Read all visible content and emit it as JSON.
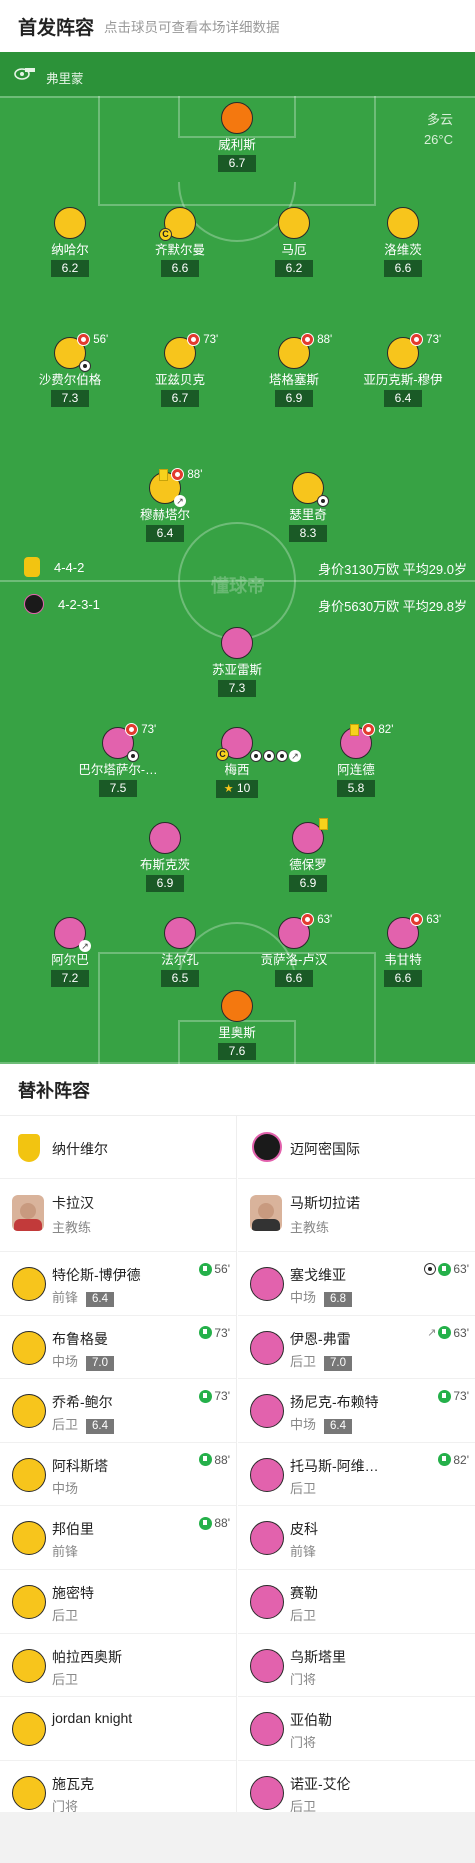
{
  "header": {
    "title": "首发阵容",
    "hint": "点击球员可查看本场详细数据"
  },
  "referee": {
    "name": "弗里蒙",
    "icon": "whistle-icon"
  },
  "weather": {
    "condition": "多云",
    "temp": "26°C"
  },
  "watermark": "懂球帝",
  "home_team": {
    "formation": "4-4-2",
    "value_text": "身价3130万欧 平均29.0岁"
  },
  "away_team": {
    "formation": "4-2-3-1",
    "value_text": "身价5630万欧 平均29.8岁"
  },
  "home_players": [
    {
      "name": "威利斯",
      "rating": "6.7"
    },
    {
      "name": "纳哈尔",
      "rating": "6.2"
    },
    {
      "name": "齐默尔曼",
      "rating": "6.6"
    },
    {
      "name": "马厄",
      "rating": "6.2"
    },
    {
      "name": "洛维茨",
      "rating": "6.6"
    },
    {
      "name": "沙费尔伯格",
      "rating": "7.3",
      "sub": "56'"
    },
    {
      "name": "亚兹贝克",
      "rating": "6.7",
      "sub": "73'"
    },
    {
      "name": "塔格塞斯",
      "rating": "6.9",
      "sub": "88'"
    },
    {
      "name": "亚历克斯-穆伊",
      "rating": "6.4",
      "sub": "73'"
    },
    {
      "name": "穆赫塔尔",
      "rating": "6.4",
      "sub": "88'"
    },
    {
      "name": "瑟里奇",
      "rating": "8.3"
    }
  ],
  "away_players": [
    {
      "name": "苏亚雷斯",
      "rating": "7.3"
    },
    {
      "name": "巴尔塔萨尔-…",
      "rating": "7.5",
      "sub": "73'"
    },
    {
      "name": "梅西",
      "rating": "10"
    },
    {
      "name": "阿连德",
      "rating": "5.8",
      "sub": "82'"
    },
    {
      "name": "布斯克茨",
      "rating": "6.9"
    },
    {
      "name": "德保罗",
      "rating": "6.9"
    },
    {
      "name": "阿尔巴",
      "rating": "7.2"
    },
    {
      "name": "法尔孔",
      "rating": "6.5"
    },
    {
      "name": "贡萨洛-卢汉",
      "rating": "6.6",
      "sub": "63'"
    },
    {
      "name": "韦甘特",
      "rating": "6.6",
      "sub": "63'"
    },
    {
      "name": "里奥斯",
      "rating": "7.6"
    }
  ],
  "subs": {
    "title": "替补阵容",
    "home": {
      "team": "纳什维尔",
      "coach": {
        "name": "卡拉汉",
        "role": "主教练"
      },
      "players": [
        {
          "name": "特伦斯-博伊德",
          "pos": "前锋",
          "rating": "6.4",
          "in": "56'"
        },
        {
          "name": "布鲁格曼",
          "pos": "中场",
          "rating": "7.0",
          "in": "73'"
        },
        {
          "name": "乔希-鲍尔",
          "pos": "后卫",
          "rating": "6.4",
          "in": "73'"
        },
        {
          "name": "阿科斯塔",
          "pos": "中场",
          "rating": "",
          "in": "88'"
        },
        {
          "name": "邦伯里",
          "pos": "前锋",
          "rating": "",
          "in": "88'"
        },
        {
          "name": "施密特",
          "pos": "后卫",
          "rating": "",
          "in": ""
        },
        {
          "name": "帕拉西奥斯",
          "pos": "后卫",
          "rating": "",
          "in": ""
        },
        {
          "name": "jordan knight",
          "pos": "",
          "rating": "",
          "in": ""
        },
        {
          "name": "施瓦克",
          "pos": "门将",
          "rating": "",
          "in": ""
        }
      ]
    },
    "away": {
      "team": "迈阿密国际",
      "coach": {
        "name": "马斯切拉诺",
        "role": "主教练"
      },
      "players": [
        {
          "name": "塞戈维亚",
          "pos": "中场",
          "rating": "6.8",
          "in": "63'"
        },
        {
          "name": "伊恩-弗雷",
          "pos": "后卫",
          "rating": "7.0",
          "in": "63'"
        },
        {
          "name": "扬尼克-布赖特",
          "pos": "中场",
          "rating": "6.4",
          "in": "73'"
        },
        {
          "name": "托马斯-阿维…",
          "pos": "后卫",
          "rating": "",
          "in": "82'"
        },
        {
          "name": "皮科",
          "pos": "前锋",
          "rating": "",
          "in": ""
        },
        {
          "name": "赛勒",
          "pos": "后卫",
          "rating": "",
          "in": ""
        },
        {
          "name": "乌斯塔里",
          "pos": "门将",
          "rating": "",
          "in": ""
        },
        {
          "name": "亚伯勒",
          "pos": "门将",
          "rating": "",
          "in": ""
        },
        {
          "name": "诺亚-艾伦",
          "pos": "后卫",
          "rating": "",
          "in": ""
        }
      ]
    }
  }
}
